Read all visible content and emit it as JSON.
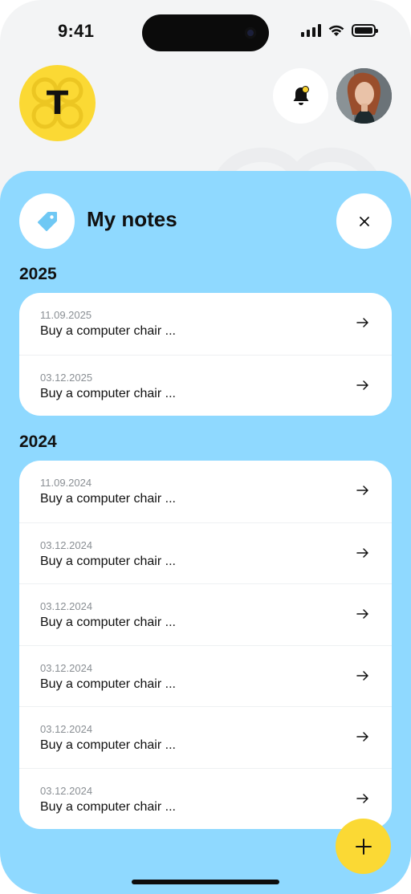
{
  "status_bar": {
    "time": "9:41"
  },
  "header": {
    "logo_letter": "T",
    "icons": {
      "notifications": "bell-icon",
      "profile": "avatar"
    }
  },
  "notes": {
    "title": "My notes",
    "groups": [
      {
        "year": "2025",
        "items": [
          {
            "date": "11.09.2025",
            "text": "Buy a computer chair ..."
          },
          {
            "date": "03.12.2025",
            "text": "Buy a computer chair ..."
          }
        ]
      },
      {
        "year": "2024",
        "items": [
          {
            "date": "11.09.2024",
            "text": "Buy a computer chair ..."
          },
          {
            "date": "03.12.2024",
            "text": "Buy a computer chair ..."
          },
          {
            "date": "03.12.2024",
            "text": "Buy a computer chair ..."
          },
          {
            "date": "03.12.2024",
            "text": "Buy a computer chair ..."
          },
          {
            "date": "03.12.2024",
            "text": "Buy a computer chair ..."
          },
          {
            "date": "03.12.2024",
            "text": "Buy a computer chair ..."
          }
        ]
      }
    ]
  },
  "colors": {
    "accent_yellow": "#fbd934",
    "sheet_blue": "#8fd9ff",
    "background": "#f3f4f5",
    "card": "#ffffff"
  }
}
